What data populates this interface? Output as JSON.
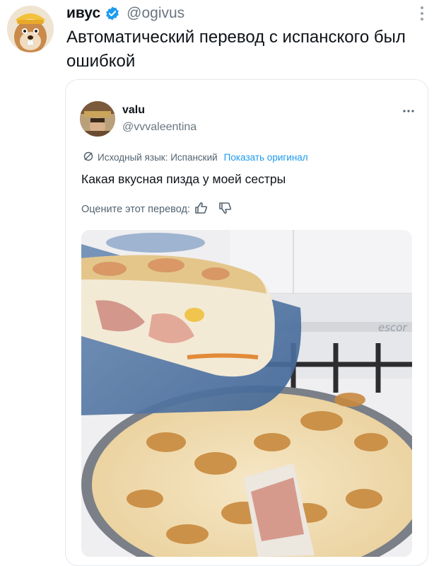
{
  "tweet": {
    "author_name": "ивус",
    "handle": "@ogivus",
    "text": "Автоматический перевод с испанского был ошибкой"
  },
  "quoted_tweet": {
    "author_name": "valu",
    "handle": "@vvvaleentina",
    "source_language": "Исходный язык: Испанский",
    "show_original": "Показать оригинал",
    "translated_text": "Какая вкусная пизда у моей сестры",
    "rate_translation": "Оцените этот перевод:"
  },
  "image": {
    "stove_brand": "escor"
  },
  "colors": {
    "link": "#1d9bf0",
    "verified": "#1d9bf0",
    "secondary_text": "#536471"
  },
  "icons": {
    "verified": "verified-badge-icon",
    "more": "more-dots-icon",
    "translate": "translate-icon",
    "thumbs_up": "thumbs-up-icon",
    "thumbs_down": "thumbs-down-icon"
  }
}
